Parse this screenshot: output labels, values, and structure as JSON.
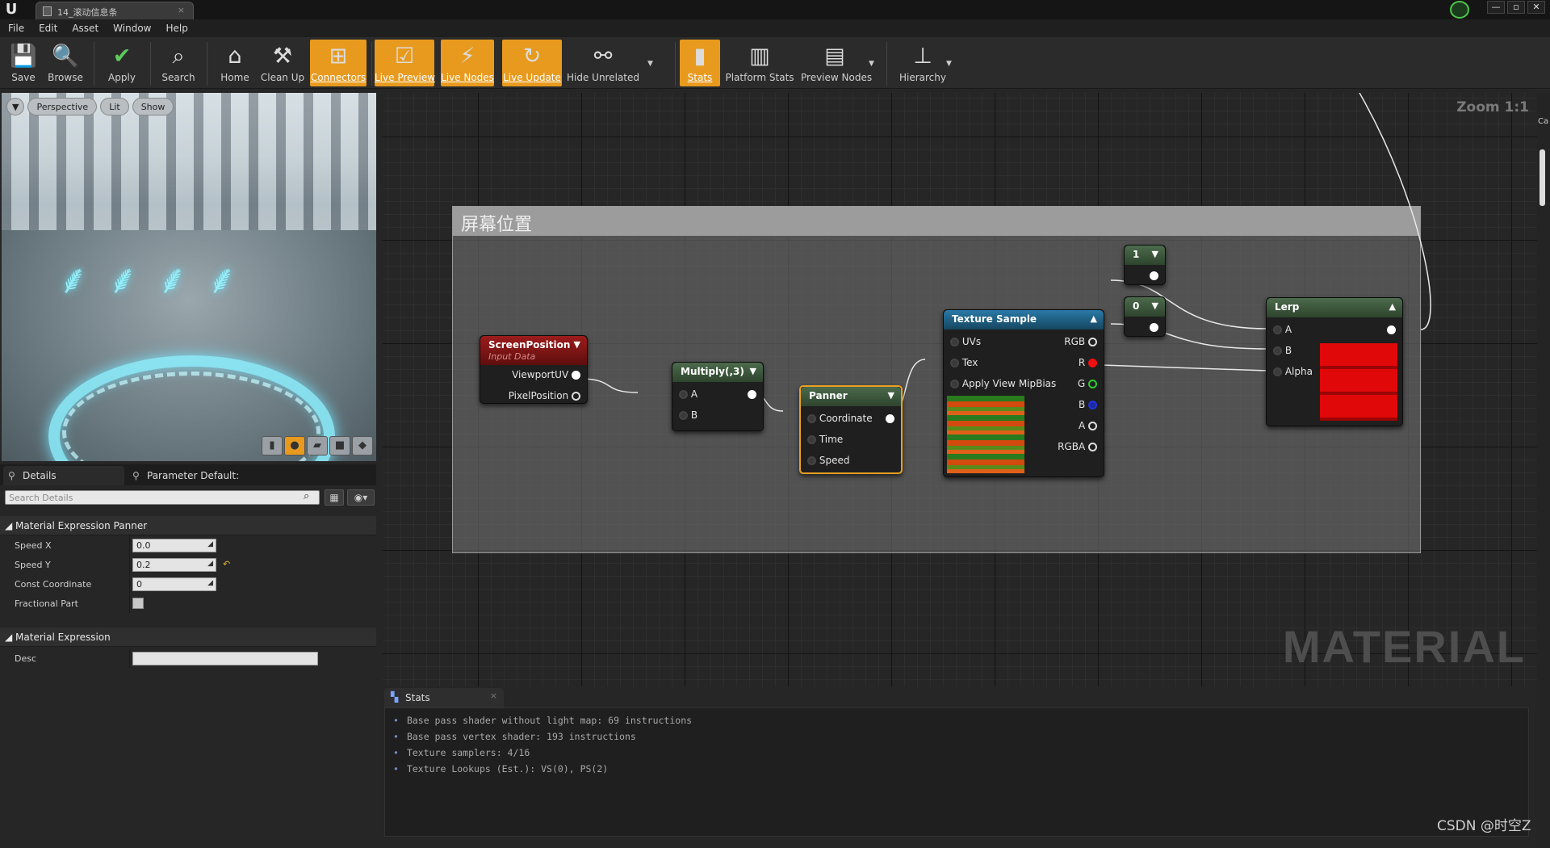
{
  "window": {
    "tab_title": "14_滚动信息条",
    "controls": [
      "—",
      "▫",
      "✕"
    ]
  },
  "menu": [
    "File",
    "Edit",
    "Asset",
    "Window",
    "Help"
  ],
  "toolbar": {
    "save": "Save",
    "browse": "Browse",
    "apply": "Apply",
    "search": "Search",
    "home": "Home",
    "cleanup": "Clean Up",
    "connectors": "Connectors",
    "live_preview": "Live Preview",
    "live_nodes": "Live Nodes",
    "live_update": "Live Update",
    "hide_unrelated": "Hide Unrelated",
    "stats": "Stats",
    "platform_stats": "Platform Stats",
    "preview_nodes": "Preview Nodes",
    "hierarchy": "Hierarchy",
    "active": [
      "Connectors",
      "Live Preview",
      "Live Nodes",
      "Live Update",
      "Stats"
    ],
    "accent_color": "#e89a1e"
  },
  "viewport": {
    "perspective": "Perspective",
    "lit": "Lit",
    "show": "Show"
  },
  "details": {
    "tab_details": "Details",
    "tab_params": "Parameter Default:",
    "search_placeholder": "Search Details",
    "section_panner": "Material Expression Panner",
    "speed_x_label": "Speed X",
    "speed_x": "0.0",
    "speed_y_label": "Speed Y",
    "speed_y": "0.2",
    "const_coord_label": "Const Coordinate",
    "const_coord": "0",
    "fractional_label": "Fractional Part",
    "section_expr": "Material Expression",
    "desc_label": "Desc"
  },
  "graph": {
    "zoom": "Zoom 1:1",
    "watermark": "MATERIAL",
    "comment": "屏幕位置",
    "nodes": {
      "screen_position": {
        "title": "ScreenPosition",
        "subtitle": "Input Data",
        "pins": [
          "ViewportUV",
          "PixelPosition"
        ],
        "color": "#8b1414"
      },
      "multiply": {
        "title": "Multiply(,3)",
        "pins": [
          "A",
          "B"
        ],
        "color": "#3e5a3e"
      },
      "panner": {
        "title": "Panner",
        "pins": [
          "Coordinate",
          "Time",
          "Speed"
        ],
        "color": "#3e5a3e"
      },
      "texture_sample": {
        "title": "Texture Sample",
        "inputs": [
          "UVs",
          "Tex",
          "Apply View MipBias"
        ],
        "outputs": [
          "RGB",
          "R",
          "G",
          "B",
          "A",
          "RGBA"
        ],
        "color": "#1f5f86"
      },
      "const_1": {
        "title": "1"
      },
      "const_0": {
        "title": "0"
      },
      "lerp": {
        "title": "Lerp",
        "pins": [
          "A",
          "B",
          "Alpha"
        ],
        "color": "#3e5a3e"
      }
    }
  },
  "stats": {
    "tab": "Stats",
    "lines": [
      "Base pass shader without light map: 69 instructions",
      "Base pass vertex shader: 193 instructions",
      "Texture samplers: 4/16",
      "Texture Lookups (Est.): VS(0), PS(2)"
    ]
  },
  "right_strip_label": "Ca",
  "credit": "CSDN @时空Z"
}
